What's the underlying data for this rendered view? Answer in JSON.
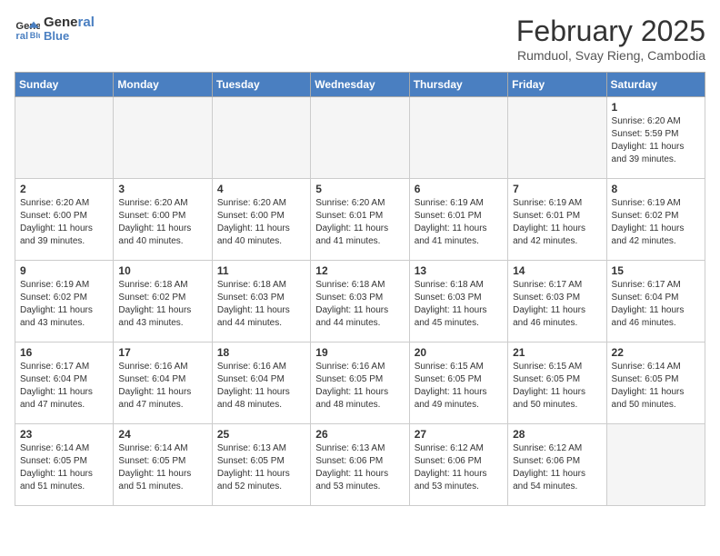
{
  "header": {
    "logo_line1": "General",
    "logo_line2": "Blue",
    "month_title": "February 2025",
    "subtitle": "Rumduol, Svay Rieng, Cambodia"
  },
  "weekdays": [
    "Sunday",
    "Monday",
    "Tuesday",
    "Wednesday",
    "Thursday",
    "Friday",
    "Saturday"
  ],
  "weeks": [
    [
      {
        "day": "",
        "info": ""
      },
      {
        "day": "",
        "info": ""
      },
      {
        "day": "",
        "info": ""
      },
      {
        "day": "",
        "info": ""
      },
      {
        "day": "",
        "info": ""
      },
      {
        "day": "",
        "info": ""
      },
      {
        "day": "1",
        "info": "Sunrise: 6:20 AM\nSunset: 5:59 PM\nDaylight: 11 hours and 39 minutes."
      }
    ],
    [
      {
        "day": "2",
        "info": "Sunrise: 6:20 AM\nSunset: 6:00 PM\nDaylight: 11 hours and 39 minutes."
      },
      {
        "day": "3",
        "info": "Sunrise: 6:20 AM\nSunset: 6:00 PM\nDaylight: 11 hours and 40 minutes."
      },
      {
        "day": "4",
        "info": "Sunrise: 6:20 AM\nSunset: 6:00 PM\nDaylight: 11 hours and 40 minutes."
      },
      {
        "day": "5",
        "info": "Sunrise: 6:20 AM\nSunset: 6:01 PM\nDaylight: 11 hours and 41 minutes."
      },
      {
        "day": "6",
        "info": "Sunrise: 6:19 AM\nSunset: 6:01 PM\nDaylight: 11 hours and 41 minutes."
      },
      {
        "day": "7",
        "info": "Sunrise: 6:19 AM\nSunset: 6:01 PM\nDaylight: 11 hours and 42 minutes."
      },
      {
        "day": "8",
        "info": "Sunrise: 6:19 AM\nSunset: 6:02 PM\nDaylight: 11 hours and 42 minutes."
      }
    ],
    [
      {
        "day": "9",
        "info": "Sunrise: 6:19 AM\nSunset: 6:02 PM\nDaylight: 11 hours and 43 minutes."
      },
      {
        "day": "10",
        "info": "Sunrise: 6:18 AM\nSunset: 6:02 PM\nDaylight: 11 hours and 43 minutes."
      },
      {
        "day": "11",
        "info": "Sunrise: 6:18 AM\nSunset: 6:03 PM\nDaylight: 11 hours and 44 minutes."
      },
      {
        "day": "12",
        "info": "Sunrise: 6:18 AM\nSunset: 6:03 PM\nDaylight: 11 hours and 44 minutes."
      },
      {
        "day": "13",
        "info": "Sunrise: 6:18 AM\nSunset: 6:03 PM\nDaylight: 11 hours and 45 minutes."
      },
      {
        "day": "14",
        "info": "Sunrise: 6:17 AM\nSunset: 6:03 PM\nDaylight: 11 hours and 46 minutes."
      },
      {
        "day": "15",
        "info": "Sunrise: 6:17 AM\nSunset: 6:04 PM\nDaylight: 11 hours and 46 minutes."
      }
    ],
    [
      {
        "day": "16",
        "info": "Sunrise: 6:17 AM\nSunset: 6:04 PM\nDaylight: 11 hours and 47 minutes."
      },
      {
        "day": "17",
        "info": "Sunrise: 6:16 AM\nSunset: 6:04 PM\nDaylight: 11 hours and 47 minutes."
      },
      {
        "day": "18",
        "info": "Sunrise: 6:16 AM\nSunset: 6:04 PM\nDaylight: 11 hours and 48 minutes."
      },
      {
        "day": "19",
        "info": "Sunrise: 6:16 AM\nSunset: 6:05 PM\nDaylight: 11 hours and 48 minutes."
      },
      {
        "day": "20",
        "info": "Sunrise: 6:15 AM\nSunset: 6:05 PM\nDaylight: 11 hours and 49 minutes."
      },
      {
        "day": "21",
        "info": "Sunrise: 6:15 AM\nSunset: 6:05 PM\nDaylight: 11 hours and 50 minutes."
      },
      {
        "day": "22",
        "info": "Sunrise: 6:14 AM\nSunset: 6:05 PM\nDaylight: 11 hours and 50 minutes."
      }
    ],
    [
      {
        "day": "23",
        "info": "Sunrise: 6:14 AM\nSunset: 6:05 PM\nDaylight: 11 hours and 51 minutes."
      },
      {
        "day": "24",
        "info": "Sunrise: 6:14 AM\nSunset: 6:05 PM\nDaylight: 11 hours and 51 minutes."
      },
      {
        "day": "25",
        "info": "Sunrise: 6:13 AM\nSunset: 6:05 PM\nDaylight: 11 hours and 52 minutes."
      },
      {
        "day": "26",
        "info": "Sunrise: 6:13 AM\nSunset: 6:06 PM\nDaylight: 11 hours and 53 minutes."
      },
      {
        "day": "27",
        "info": "Sunrise: 6:12 AM\nSunset: 6:06 PM\nDaylight: 11 hours and 53 minutes."
      },
      {
        "day": "28",
        "info": "Sunrise: 6:12 AM\nSunset: 6:06 PM\nDaylight: 11 hours and 54 minutes."
      },
      {
        "day": "",
        "info": ""
      }
    ]
  ]
}
